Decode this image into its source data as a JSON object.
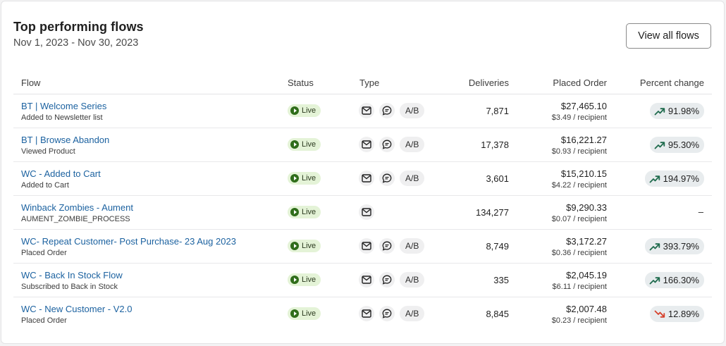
{
  "header": {
    "title": "Top performing flows",
    "date_range": "Nov 1, 2023 - Nov 30, 2023",
    "view_all_label": "View all flows"
  },
  "columns": {
    "flow": "Flow",
    "status": "Status",
    "type": "Type",
    "deliveries": "Deliveries",
    "placed_order": "Placed Order",
    "percent_change": "Percent change"
  },
  "rows": [
    {
      "name": "BT | Welcome Series",
      "trigger": "Added to Newsletter list",
      "status": "Live",
      "email": true,
      "sms": true,
      "ab": "A/B",
      "deliveries": "7,871",
      "placed_order": "$27,465.10",
      "per_recipient": "$3.49 / recipient",
      "percent": "91.98%",
      "trend": "up"
    },
    {
      "name": "BT | Browse Abandon",
      "trigger": "Viewed Product",
      "status": "Live",
      "email": true,
      "sms": true,
      "ab": "A/B",
      "deliveries": "17,378",
      "placed_order": "$16,221.27",
      "per_recipient": "$0.93 / recipient",
      "percent": "95.30%",
      "trend": "up"
    },
    {
      "name": "WC - Added to Cart",
      "trigger": "Added to Cart",
      "status": "Live",
      "email": true,
      "sms": true,
      "ab": "A/B",
      "deliveries": "3,601",
      "placed_order": "$15,210.15",
      "per_recipient": "$4.22 / recipient",
      "percent": "194.97%",
      "trend": "up"
    },
    {
      "name": "Winback Zombies - Aument",
      "trigger": "AUMENT_ZOMBIE_PROCESS",
      "status": "Live",
      "email": true,
      "sms": false,
      "ab": "",
      "deliveries": "134,277",
      "placed_order": "$9,290.33",
      "per_recipient": "$0.07 / recipient",
      "percent": "–",
      "trend": "none"
    },
    {
      "name": "WC- Repeat Customer- Post Purchase- 23 Aug 2023",
      "trigger": "Placed Order",
      "status": "Live",
      "email": true,
      "sms": true,
      "ab": "A/B",
      "deliveries": "8,749",
      "placed_order": "$3,172.27",
      "per_recipient": "$0.36 / recipient",
      "percent": "393.79%",
      "trend": "up"
    },
    {
      "name": "WC - Back In Stock Flow",
      "trigger": "Subscribed to Back in Stock",
      "status": "Live",
      "email": true,
      "sms": true,
      "ab": "A/B",
      "deliveries": "335",
      "placed_order": "$2,045.19",
      "per_recipient": "$6.11 / recipient",
      "percent": "166.30%",
      "trend": "up"
    },
    {
      "name": "WC - New Customer - V2.0",
      "trigger": "Placed Order",
      "status": "Live",
      "email": true,
      "sms": true,
      "ab": "A/B",
      "deliveries": "8,845",
      "placed_order": "$2,007.48",
      "per_recipient": "$0.23 / recipient",
      "percent": "12.89%",
      "trend": "down"
    }
  ],
  "colors": {
    "link": "#1c62a0",
    "live_bg": "#e4f3d7",
    "live_dot": "#2f6d1a",
    "trend_up": "#1f6b4d",
    "trend_down": "#d6412c"
  }
}
